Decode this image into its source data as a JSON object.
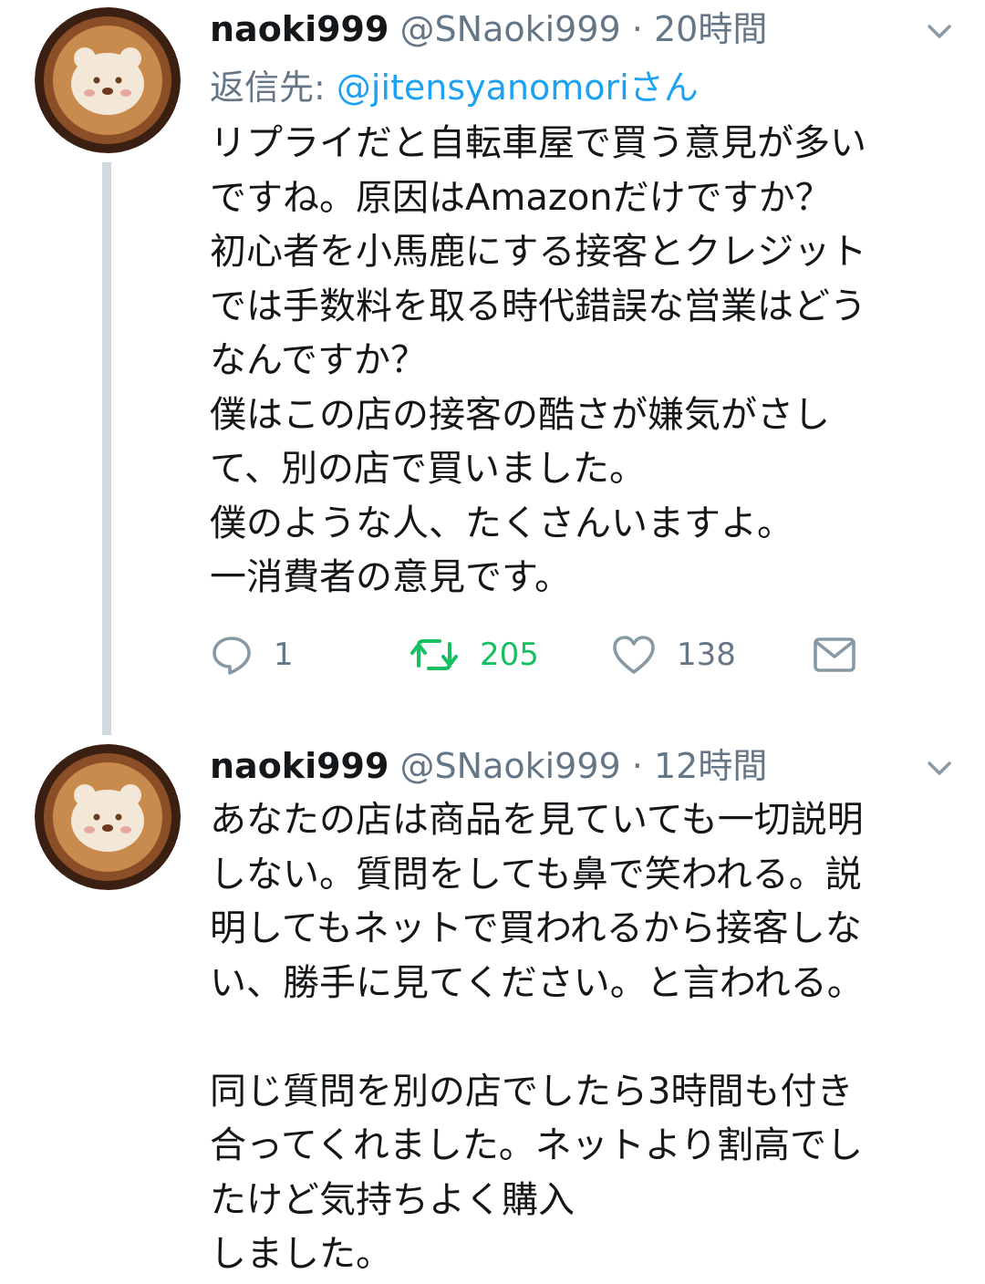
{
  "tweets": [
    {
      "name": "naoki999",
      "handle": "@SNaoki999",
      "separator": "·",
      "time": "20時間",
      "reply_to_label": "返信先: ",
      "reply_to_mention": "@jitensyanomoriさん",
      "text": "リプライだと自転車屋で買う意見が多い\nですね。原因はAmazonだけですか？\n初心者を小馬鹿にする接客とクレジット\nでは手数料を取る時代錯誤な営業はどう\nなんですか？\n僕はこの店の接客の酷さが嫌気がさし\nて、別の店で買いました。\n僕のような人、たくさんいますよ。\n一消費者の意見です。",
      "reply_count": "1",
      "retweet_count": "205",
      "like_count": "138"
    },
    {
      "name": "naoki999",
      "handle": "@SNaoki999",
      "separator": "·",
      "time": "12時間",
      "text": "あなたの店は商品を見ていても一切説明\nしない。質問をしても鼻で笑われる。説\n明してもネットで買われるから接客しな\nい、勝手に見てください。と言われる。\n\n同じ質問を別の店でしたら3時間も付き\n合ってくれました。ネットより割高でし\nたけど気持ちよく購入\nしました。"
    }
  ],
  "colors": {
    "text": "#14171a",
    "secondary": "#657786",
    "mention": "#1da1f2",
    "retweet": "#17bf63",
    "thread_line": "#cfd9de"
  },
  "icons": [
    "chevron-down-icon",
    "reply-icon",
    "retweet-icon",
    "like-icon",
    "share-icon"
  ]
}
